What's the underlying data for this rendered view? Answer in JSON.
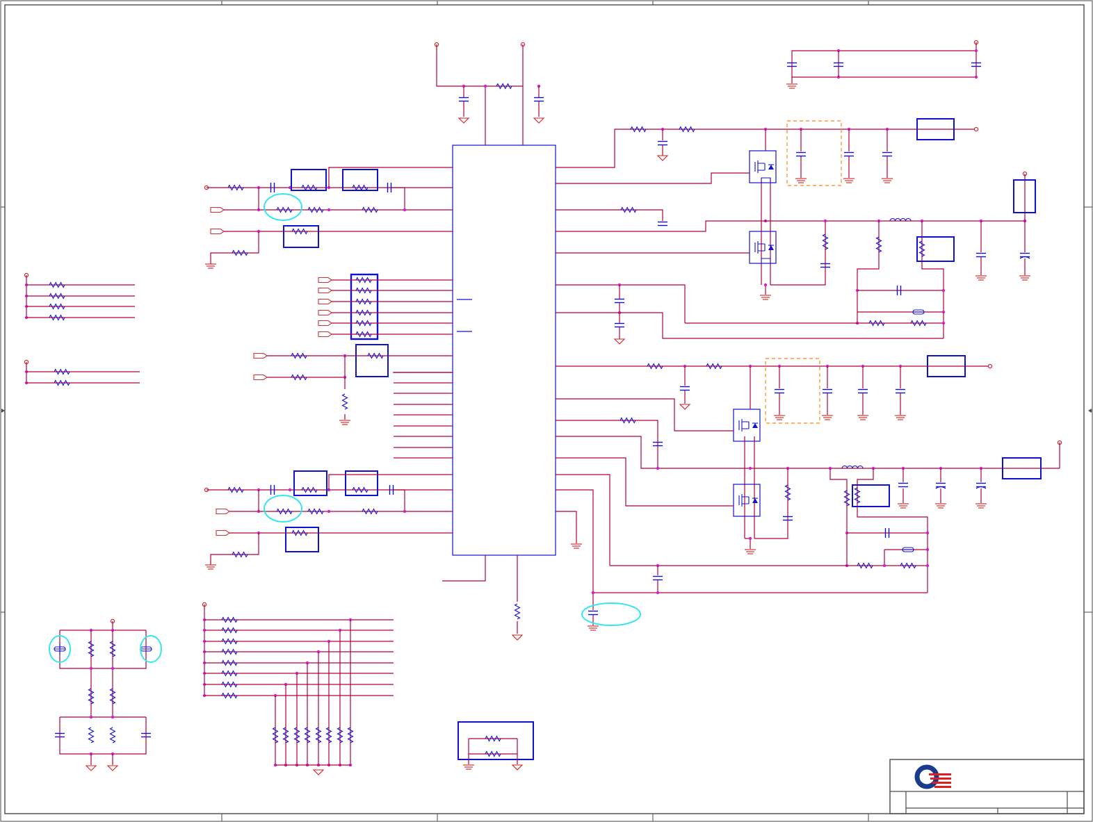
{
  "sheet": {
    "type": "electrical-schematic",
    "text_content": [],
    "colors": {
      "border": "#4a4a4a",
      "wire": "#b0003a",
      "component": "#1010d0",
      "net_dot": "#d020d0",
      "terminal": "#d03030",
      "highlight_circle": "#33e6f2",
      "dashed_region": "#ff9a33",
      "logo_blue": "#1a3a8c",
      "logo_red": "#e02020",
      "ground": "#d02020"
    },
    "symbols": [
      "resistor",
      "capacitor",
      "inductor",
      "mosfet",
      "ground",
      "power-rail",
      "net-port",
      "fuse"
    ],
    "logo": "company-logo"
  }
}
